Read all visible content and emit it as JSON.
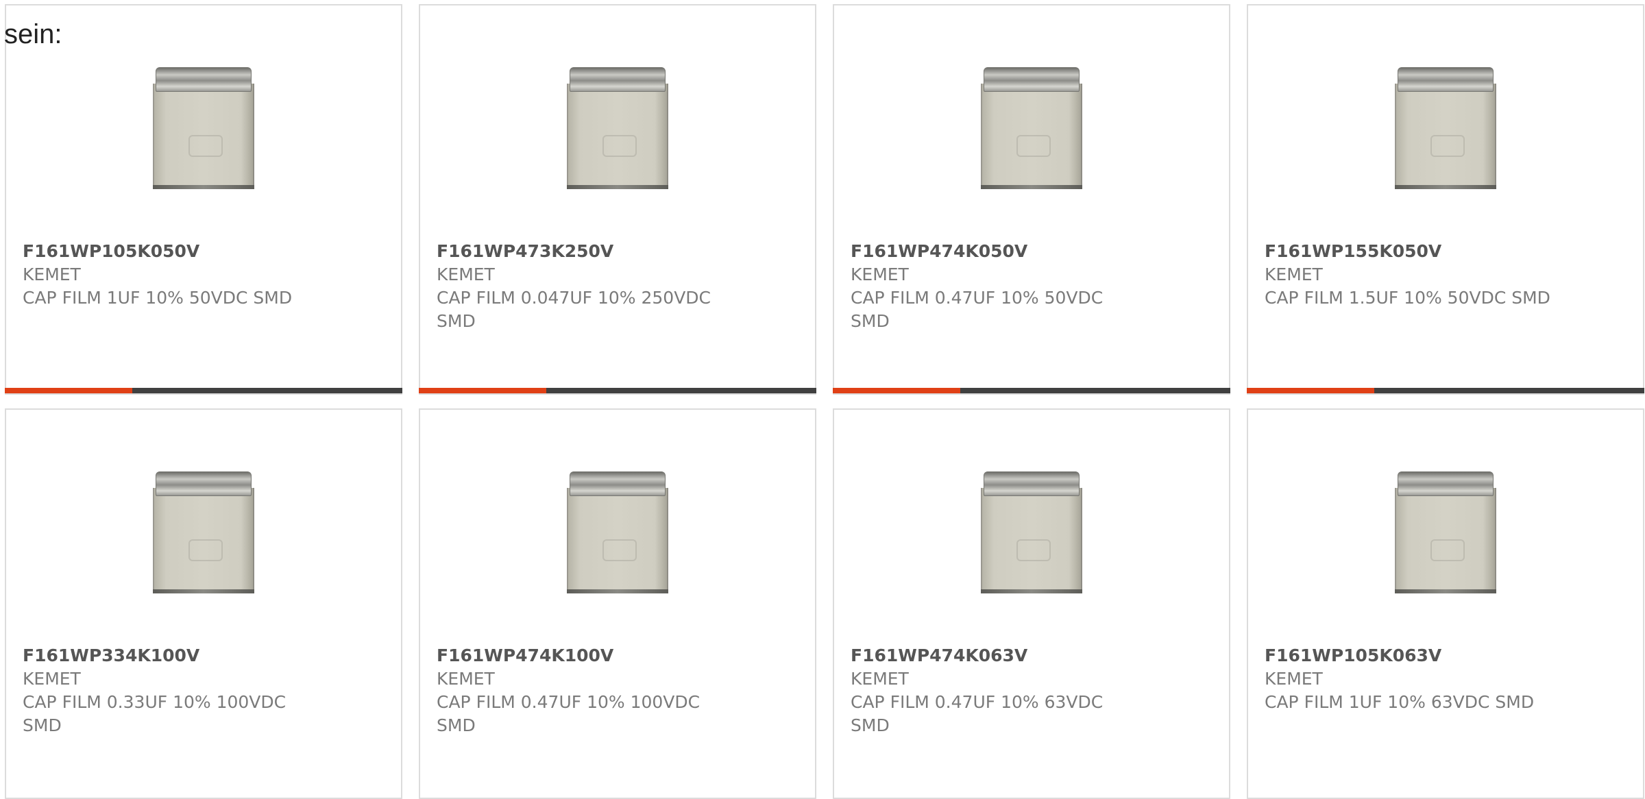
{
  "intro_text": "sein:",
  "colors": {
    "accent": "#e04016",
    "bar_track": "#404040",
    "card_border": "#dcdcdc",
    "text": "#7a7a7a",
    "part_number": "#555555"
  },
  "products": [
    {
      "part_number": "F161WP105K050V",
      "manufacturer": "KEMET",
      "description": "CAP FILM 1UF 10% 50VDC SMD",
      "image_icon": "film-capacitor-image",
      "progress": 0.32,
      "show_bar": true
    },
    {
      "part_number": "F161WP473K250V",
      "manufacturer": "KEMET",
      "description": "CAP FILM 0.047UF 10% 250VDC SMD",
      "image_icon": "film-capacitor-image",
      "progress": 0.32,
      "show_bar": true
    },
    {
      "part_number": "F161WP474K050V",
      "manufacturer": "KEMET",
      "description": "CAP FILM 0.47UF 10% 50VDC SMD",
      "image_icon": "film-capacitor-image",
      "progress": 0.32,
      "show_bar": true
    },
    {
      "part_number": "F161WP155K050V",
      "manufacturer": "KEMET",
      "description": "CAP FILM 1.5UF 10% 50VDC SMD",
      "image_icon": "film-capacitor-image",
      "progress": 0.32,
      "show_bar": true
    },
    {
      "part_number": "F161WP334K100V",
      "manufacturer": "KEMET",
      "description": "CAP FILM 0.33UF 10% 100VDC SMD",
      "image_icon": "film-capacitor-image",
      "progress": null,
      "show_bar": false
    },
    {
      "part_number": "F161WP474K100V",
      "manufacturer": "KEMET",
      "description": "CAP FILM 0.47UF 10% 100VDC SMD",
      "image_icon": "film-capacitor-image",
      "progress": null,
      "show_bar": false
    },
    {
      "part_number": "F161WP474K063V",
      "manufacturer": "KEMET",
      "description": "CAP FILM 0.47UF 10% 63VDC SMD",
      "image_icon": "film-capacitor-image",
      "progress": null,
      "show_bar": false
    },
    {
      "part_number": "F161WP105K063V",
      "manufacturer": "KEMET",
      "description": "CAP FILM 1UF 10% 63VDC SMD",
      "image_icon": "film-capacitor-image",
      "progress": null,
      "show_bar": false
    }
  ]
}
